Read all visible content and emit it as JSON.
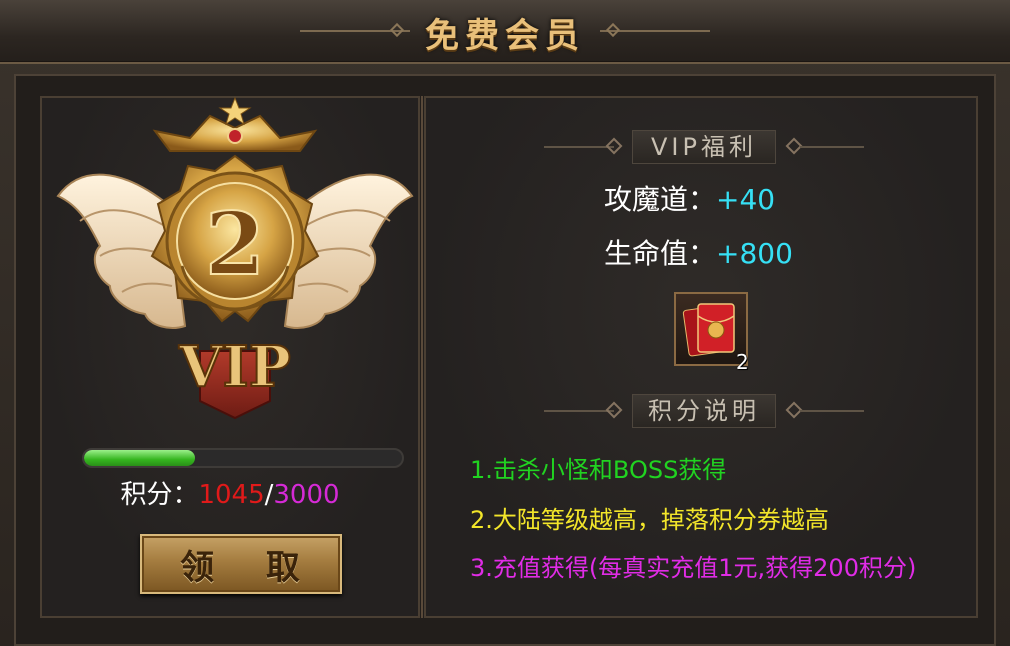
{
  "window": {
    "title": "免费会员"
  },
  "vip": {
    "level": "2",
    "badge_text": "VIP",
    "progress_fraction": 0.3483,
    "points_label": "积分：",
    "points_current": "1045",
    "points_separator": "/",
    "points_max": "3000",
    "claim_label": "领 取"
  },
  "benefits": {
    "header": "VIP福利",
    "stats": [
      {
        "label": "攻魔道：",
        "value": "+40"
      },
      {
        "label": "生命值：",
        "value": "+800"
      }
    ],
    "reward_item": {
      "icon": "red-envelope-icon",
      "count": "2"
    }
  },
  "rules": {
    "header": "积分说明",
    "items": [
      "1.击杀小怪和BOSS获得",
      "2.大陆等级越高，掉落积分券越高",
      "3.充值获得(每真实充值1元,获得200积分)"
    ]
  },
  "colors": {
    "points_current": "#e01a1a",
    "points_max": "#d52ad6",
    "stat_value": "#36e0f5",
    "rule1": "#21d321",
    "rule2": "#f2e52a",
    "rule3": "#e02ce6"
  }
}
